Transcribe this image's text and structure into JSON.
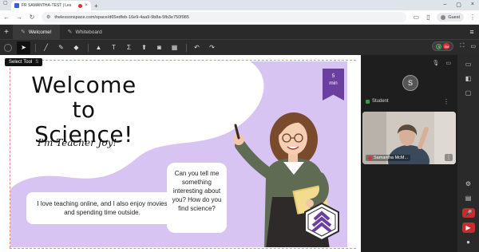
{
  "browser": {
    "tab_title": "FR SAMANTHA-TEST | Les",
    "url": "thelessonspace.com/space/d65edfeb-16e9-4aa9-9b8a-5fb3e750f985",
    "profile_label": "Guest"
  },
  "app_tabs": [
    {
      "label": "Welcome!",
      "active": true
    },
    {
      "label": "Whiteboard",
      "active": false
    }
  ],
  "toolbar": {
    "tools": [
      "select-tool",
      "pen-tool",
      "pencil-tool",
      "eraser-tool",
      "shapes-tool",
      "text-tool",
      "math-tool",
      "upload-tool",
      "camera-tool",
      "graph-tool",
      "undo",
      "redo"
    ],
    "participant_initials": [
      "S",
      "SM"
    ]
  },
  "tooltip": {
    "label": "Select Tool",
    "shortcut": "S"
  },
  "slide": {
    "title_line1": "Welcome to",
    "title_line2": "Science!",
    "subtitle": "I'm Teacher Joy!",
    "duration_value": "5",
    "duration_unit": "min",
    "bubble_left": "I love teaching online, and I also enjoy movies and spending time outside.",
    "bubble_right": "Can you tell me something interesting about you? How do you find science?",
    "colors": {
      "background": "#d7c4f3",
      "ribbon": "#6b3fa0"
    }
  },
  "participants": {
    "avatar_initial": "S",
    "student_label": "Student",
    "video_name": "Samantha McM..."
  }
}
